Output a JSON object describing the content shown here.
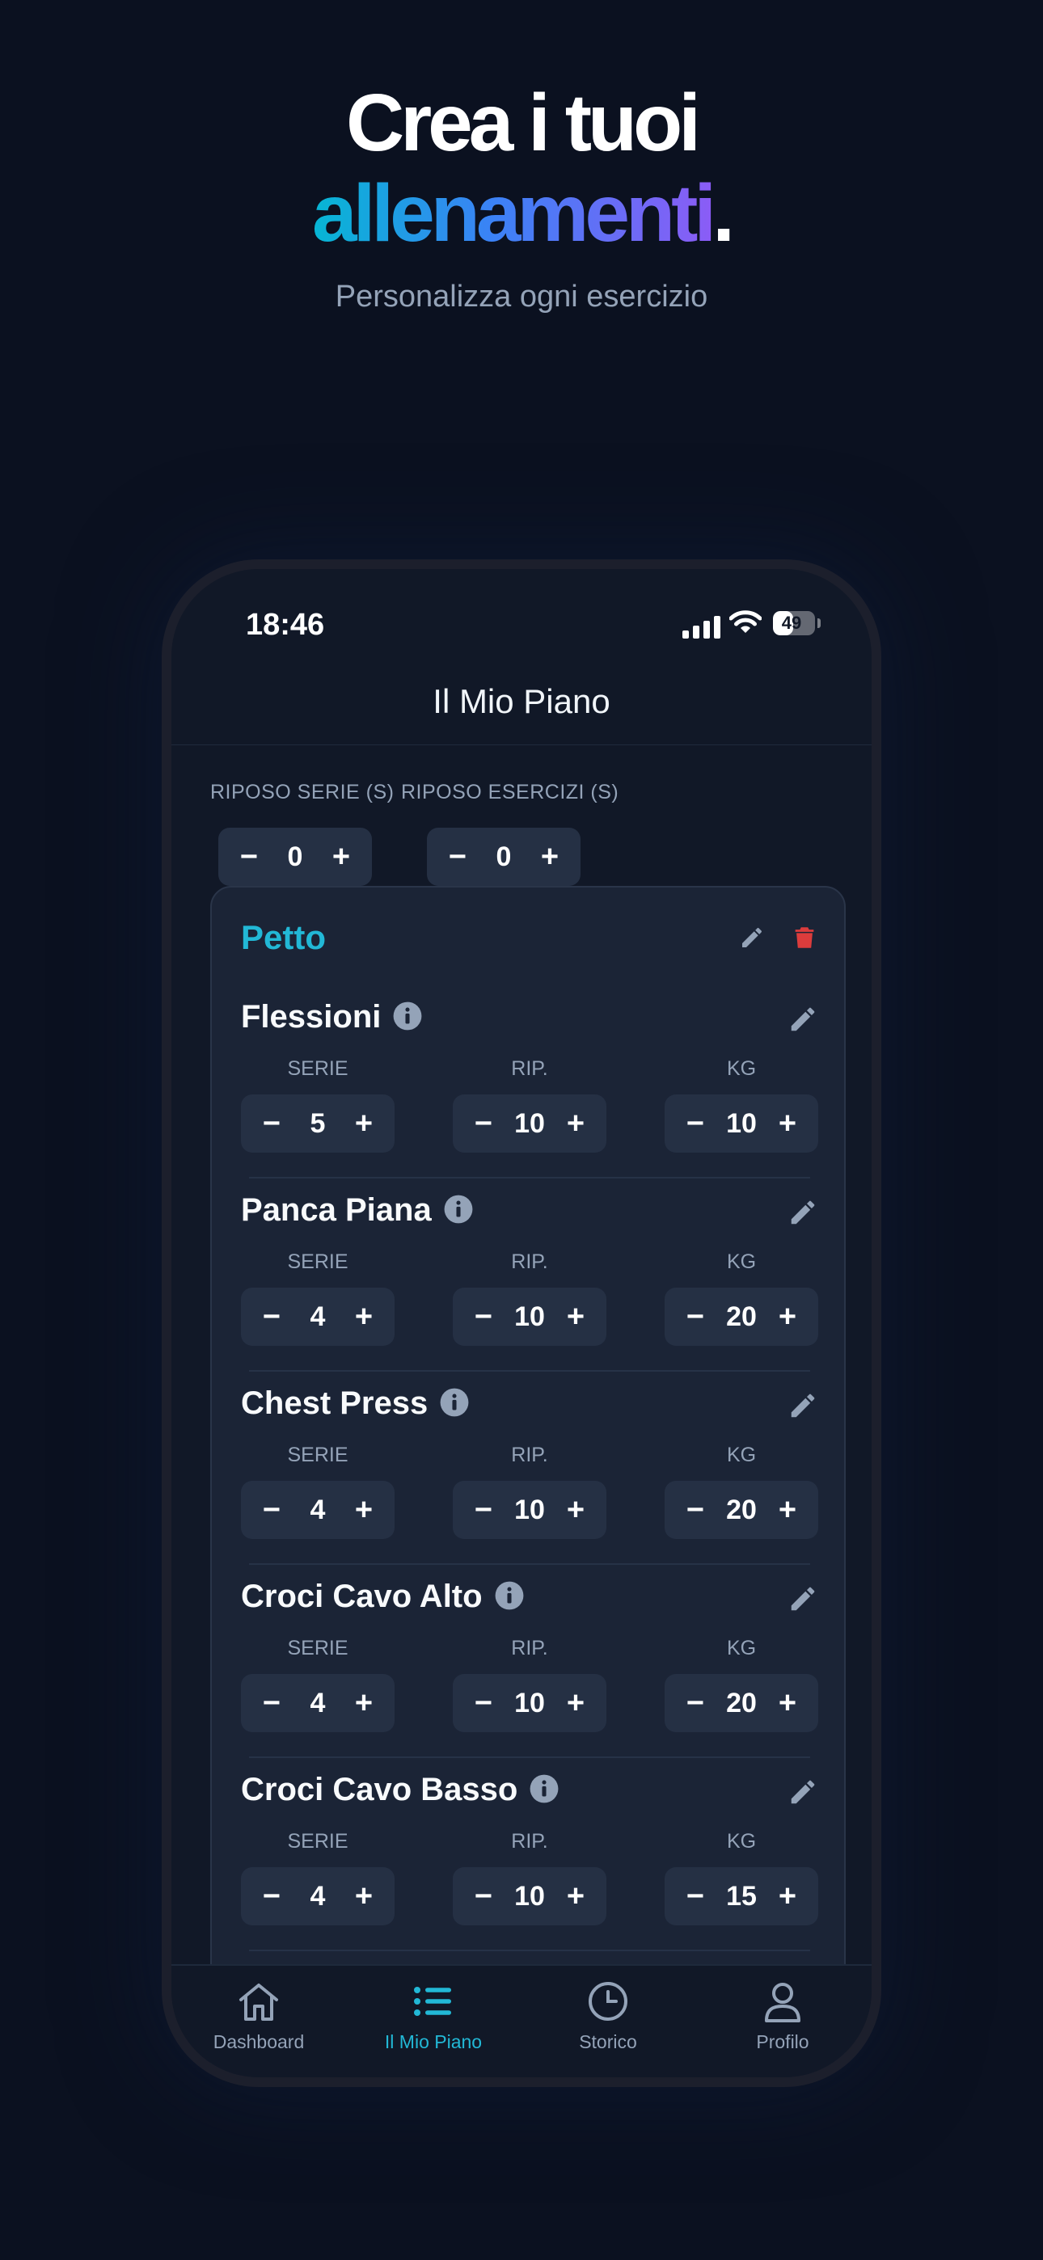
{
  "hero": {
    "line1": "Crea i tuoi",
    "line2_word": "allenamenti",
    "line2_dot": ".",
    "subtitle": "Personalizza ogni esercizio"
  },
  "status_bar": {
    "time": "18:46",
    "battery": "49",
    "battery_level": 0.49,
    "icons": [
      "signal-icon",
      "wifi-icon",
      "battery-icon"
    ]
  },
  "nav": {
    "title": "Il Mio Piano"
  },
  "rest": {
    "series": {
      "label": "RIPOSO SERIE (S)",
      "value": "0"
    },
    "exercises": {
      "label": "RIPOSO ESERCIZI (S)",
      "value": "0"
    }
  },
  "stepper": {
    "minus": "−",
    "plus": "+"
  },
  "group": {
    "name": "Petto",
    "icons": {
      "edit": "pencil-icon",
      "delete": "trash-icon"
    }
  },
  "columns": {
    "sets": "SERIE",
    "reps": "RIP.",
    "kg": "KG"
  },
  "exercises": [
    {
      "name": "Flessioni",
      "sets": "5",
      "reps": "10",
      "kg": "10"
    },
    {
      "name": "Panca Piana",
      "sets": "4",
      "reps": "10",
      "kg": "20"
    },
    {
      "name": "Chest Press",
      "sets": "4",
      "reps": "10",
      "kg": "20"
    },
    {
      "name": "Croci Cavo Alto",
      "sets": "4",
      "reps": "10",
      "kg": "20"
    },
    {
      "name": "Croci Cavo Basso",
      "sets": "4",
      "reps": "10",
      "kg": "15"
    }
  ],
  "tabs": [
    {
      "label": "Dashboard",
      "icon": "home-icon"
    },
    {
      "label": "Il Mio Piano",
      "icon": "list-icon",
      "active": true
    },
    {
      "label": "Storico",
      "icon": "clock-icon"
    },
    {
      "label": "Profilo",
      "icon": "user-icon"
    }
  ],
  "colors": {
    "background": "#0b1120",
    "accent": "#22b8d6",
    "gradient": [
      "#06b6d4",
      "#3b82f6",
      "#8b5cf6"
    ],
    "danger": "#dc3c3c",
    "card": "#1b2436",
    "stepper": "#253044"
  }
}
